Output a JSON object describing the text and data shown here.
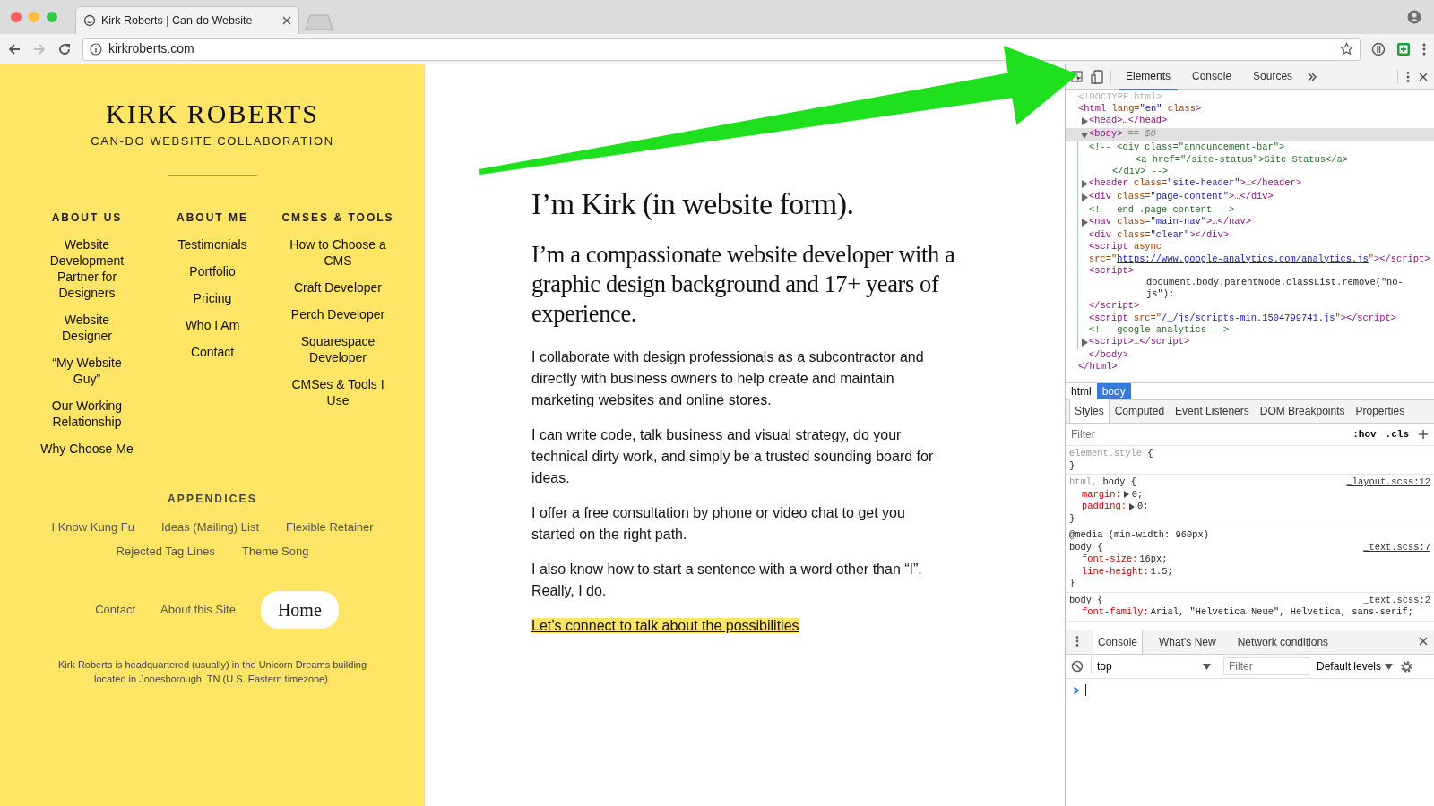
{
  "browser": {
    "tab_title": "Kirk Roberts | Can-do Website",
    "url": "kirkroberts.com"
  },
  "sidebar": {
    "site_title": "KIRK ROBERTS",
    "tagline": "CAN-DO WEBSITE COLLABORATION",
    "nav_columns": [
      {
        "heading": "ABOUT US",
        "links": [
          "Website Development Partner for Designers",
          "Website Designer",
          "“My Website Guy”",
          "Our Working Relationship",
          "Why Choose Me"
        ]
      },
      {
        "heading": "ABOUT ME",
        "links": [
          "Testimonials",
          "Portfolio",
          "Pricing",
          "Who I Am",
          "Contact"
        ]
      },
      {
        "heading": "CMSES & TOOLS",
        "links": [
          "How to Choose a CMS",
          "Craft Developer",
          "Perch Developer",
          "Squarespace Developer",
          "CMSes & Tools I Use"
        ]
      }
    ],
    "appendices": {
      "heading": "APPENDICES",
      "links": [
        "I Know Kung Fu",
        "Ideas (Mailing) List",
        "Flexible Retainer",
        "Rejected Tag Lines",
        "Theme Song"
      ]
    },
    "footer_links": [
      {
        "label": "Contact",
        "selected": false
      },
      {
        "label": "About this Site",
        "selected": false
      },
      {
        "label": "Home",
        "selected": true
      }
    ],
    "address": "Kirk Roberts is headquartered (usually) in the Unicorn Dreams building located in Jonesborough, TN (U.S. Eastern timezone)."
  },
  "main": {
    "heading": "I’m Kirk (in website form).",
    "lead": "I’m a compassionate website developer with a graphic design background and 17+ years of experience.",
    "paragraphs": [
      "I collaborate with design professionals as a subcontractor and directly with business owners to help create and maintain marketing websites and online stores.",
      "I can write code, talk business and visual strategy, do your technical dirty work, and simply be a trusted sounding board for ideas.",
      "I offer a free consultation by phone or video chat to get you started on the right path.",
      "I also know how to start a sentence with a word other than “I”. Really, I do."
    ],
    "cta": "Let’s connect to talk about the possibilities"
  },
  "devtools": {
    "tabs": [
      {
        "label": "Elements",
        "selected": true
      },
      {
        "label": "Console",
        "selected": false
      },
      {
        "label": "Sources",
        "selected": false
      }
    ],
    "dom": [
      {
        "kind": "doctype",
        "text": "<!DOCTYPE html>"
      },
      {
        "kind": "tag",
        "text": "<html lang=\"en\" class>",
        "close": "</html>",
        "children": [
          {
            "kind": "tag",
            "text": "<head>…</head>",
            "expanded": false
          },
          {
            "kind": "tag",
            "text": "<body>",
            "marker": "== $0",
            "expanded": true,
            "selected": true,
            "close": "</body>",
            "children": [
              {
                "kind": "comment",
                "lines": [
                  "<!-- <div class=\"announcement-bar\">",
                  "<a href=\"/site-status\">Site Status</a>",
                  "</div> -->"
                ]
              },
              {
                "kind": "tag",
                "text": "<header class=\"site-header\">…</header>",
                "expanded": false
              },
              {
                "kind": "tag",
                "text": "<div class=\"page-content\">…</div>",
                "expanded": false
              },
              {
                "kind": "comment",
                "lines": [
                  "<!-- end .page-content -->"
                ]
              },
              {
                "kind": "tag",
                "text": "<nav class=\"main-nav\">…</nav>",
                "expanded": false
              },
              {
                "kind": "tag",
                "text": "<div class=\"clear\"></div>"
              },
              {
                "kind": "link",
                "before": "<script async src=\"",
                "link": "https://www.google-analytics.com/analytics.js",
                "after": "\"></script>"
              },
              {
                "kind": "tag",
                "text": "<script>",
                "close": "</script>",
                "children": [
                  {
                    "kind": "text",
                    "text": "document.body.parentNode.classList.remove(\"no-js\");"
                  }
                ]
              },
              {
                "kind": "link",
                "before": "<script src=\"",
                "link": "/_/js/scripts-min.1504799741.js",
                "after": "\"></script>"
              },
              {
                "kind": "comment",
                "lines": [
                  "<!-- google analytics -->"
                ]
              },
              {
                "kind": "tag",
                "text": "<script>…</script>",
                "expanded": false
              }
            ]
          }
        ]
      }
    ],
    "breadcrumbs": [
      {
        "label": "html",
        "selected": false
      },
      {
        "label": "body",
        "selected": true
      }
    ],
    "style_tabs": [
      {
        "label": "Styles",
        "selected": true
      },
      {
        "label": "Computed",
        "selected": false
      },
      {
        "label": "Event Listeners",
        "selected": false
      },
      {
        "label": "DOM Breakpoints",
        "selected": false
      },
      {
        "label": "Properties",
        "selected": false
      }
    ],
    "filter_placeholder": "Filter",
    "hov": ":hov",
    "cls": ".cls",
    "rules": [
      {
        "selector": [
          {
            "text": "element.style",
            "matched": false
          }
        ],
        "open": "{",
        "close": "}"
      },
      {
        "selector": [
          {
            "text": "html,",
            "matched": false
          },
          {
            "text": "body",
            "matched": true
          }
        ],
        "open": "{",
        "source": "_layout.scss:12",
        "declarations": [
          {
            "property": "margin:",
            "value": "0;",
            "expandable": true
          },
          {
            "property": "padding:",
            "value": "0;",
            "expandable": true
          }
        ],
        "close": "}"
      },
      {
        "media": "@media (min-width: 960px)",
        "selector": [
          {
            "text": "body",
            "matched": true
          }
        ],
        "open": "{",
        "source": "_text.scss:7",
        "declarations": [
          {
            "property": "font-size:",
            "value": "16px;",
            "expandable": false
          },
          {
            "property": "line-height:",
            "value": "1.5;",
            "expandable": false
          }
        ],
        "close": "}"
      },
      {
        "selector": [
          {
            "text": "body",
            "matched": true
          }
        ],
        "open": "{",
        "source": "_text.scss:2",
        "declarations": [
          {
            "property": "font-family:",
            "value": "Arial, \"Helvetica Neue\", Helvetica, sans-serif;",
            "expandable": false
          }
        ]
      }
    ],
    "drawer": {
      "tabs": [
        {
          "label": "Console",
          "selected": true
        },
        {
          "label": "What's New",
          "selected": false
        },
        {
          "label": "Network conditions",
          "selected": false
        }
      ],
      "context": "top",
      "filter_placeholder": "Filter",
      "levels": "Default levels"
    }
  },
  "annotation": {
    "kind": "arrow"
  }
}
